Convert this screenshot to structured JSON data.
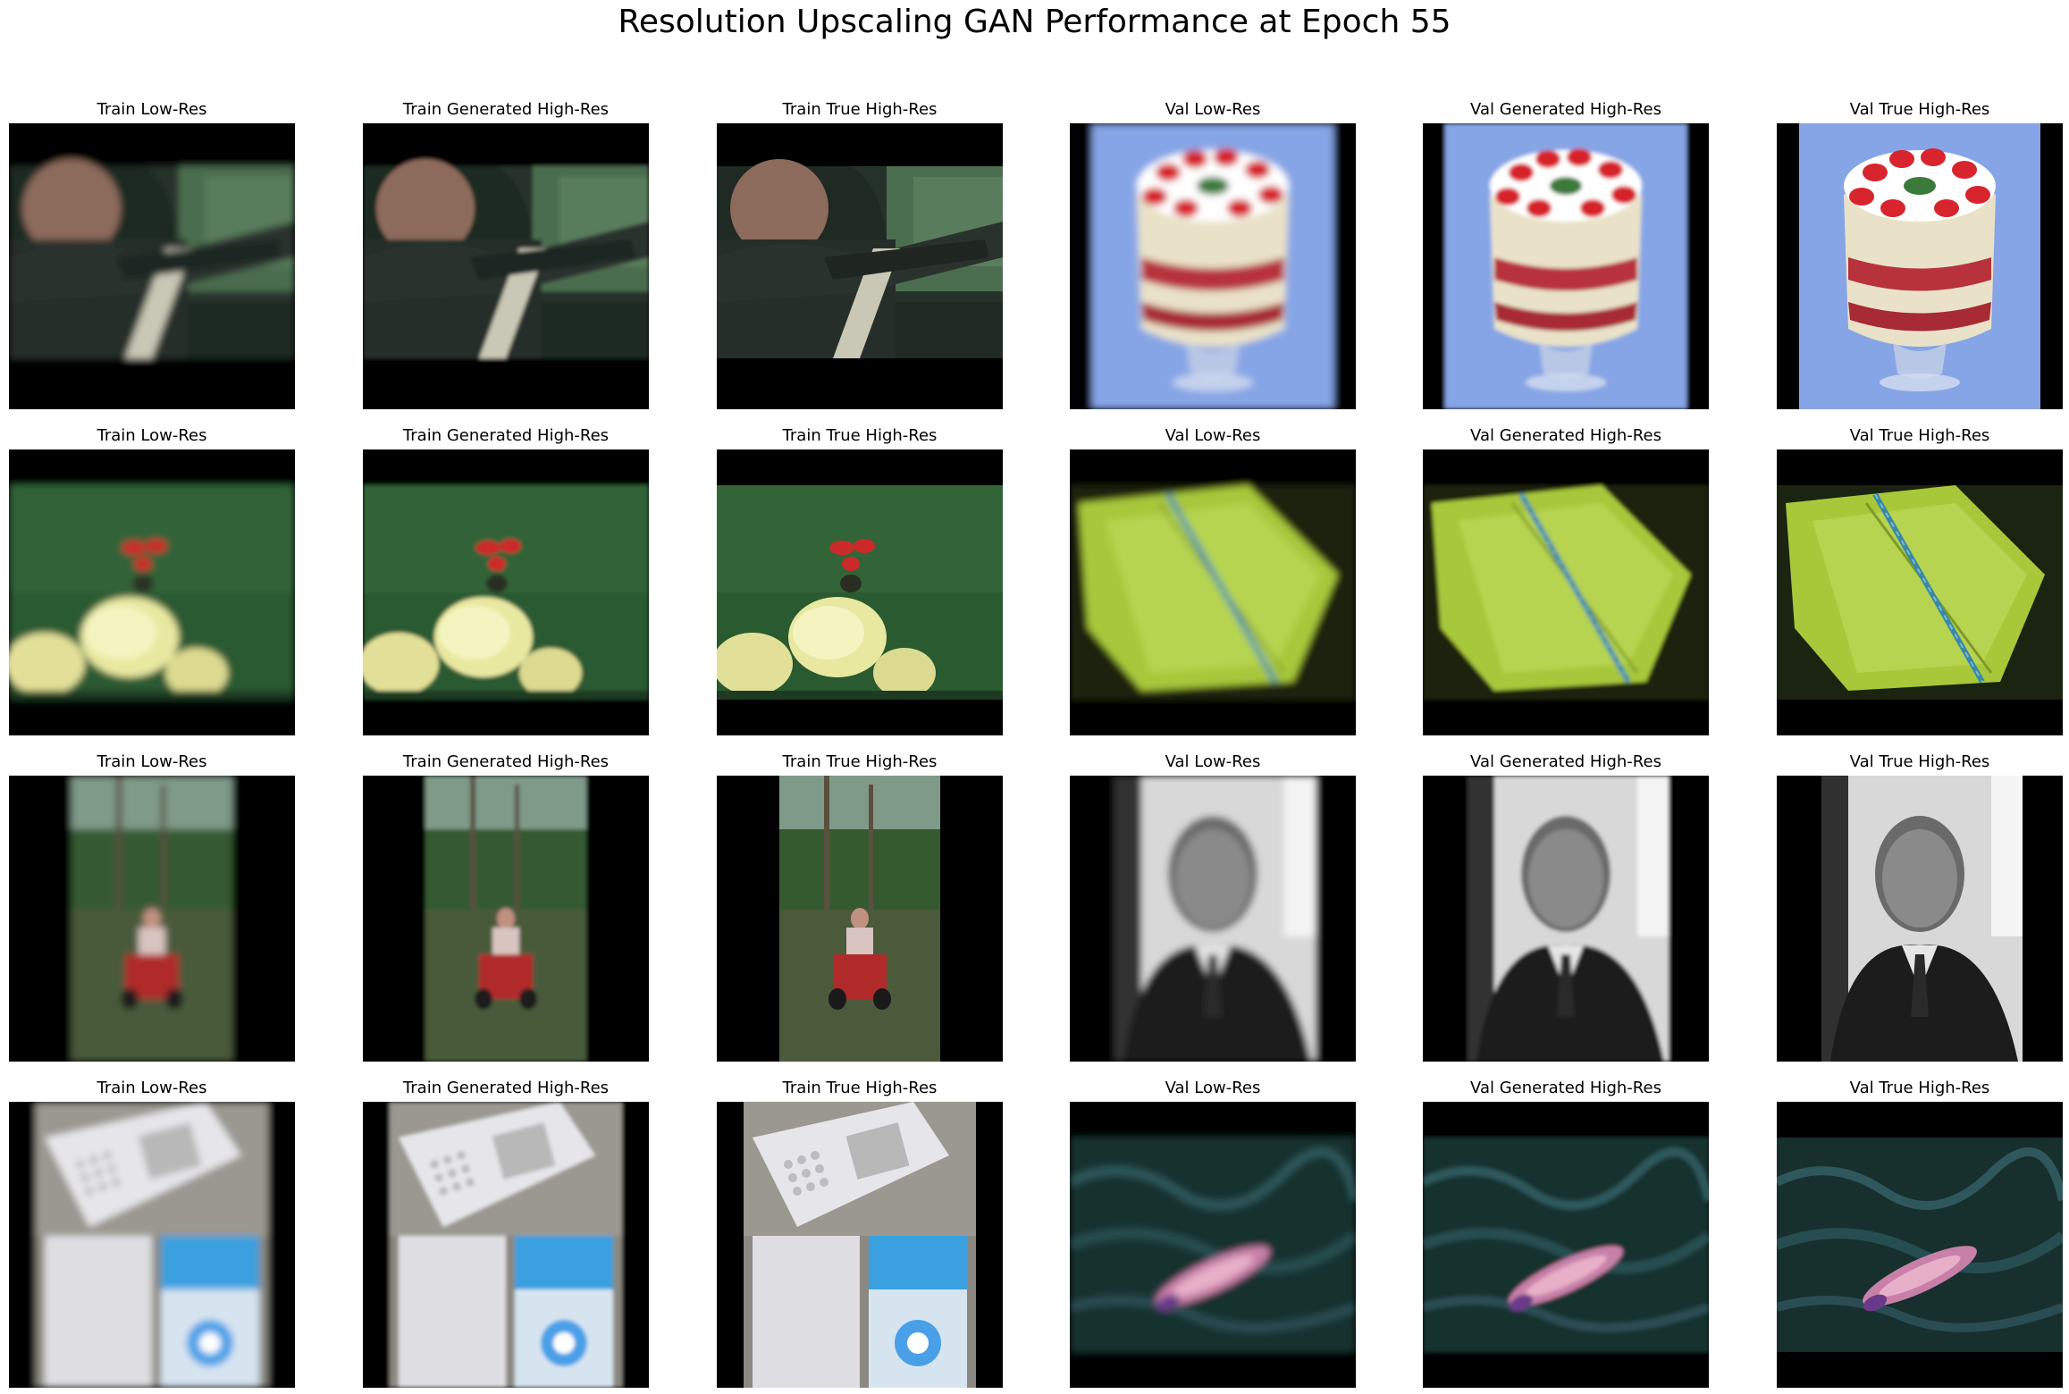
{
  "figure": {
    "title": "Resolution Upscaling GAN Performance at Epoch 55"
  },
  "column_titles": [
    "Train Low-Res",
    "Train Generated High-Res",
    "Train True High-Res",
    "Val Low-Res",
    "Val Generated High-Res",
    "Val True High-Res"
  ],
  "rows": [
    {
      "train_subject": "person driving car wearing seatbelt",
      "val_subject": "strawberry trifle dessert in glass bowl",
      "panels": [
        "Train Low-Res",
        "Train Generated High-Res",
        "Train True High-Res",
        "Val Low-Res",
        "Val Generated High-Res",
        "Val True High-Res"
      ]
    },
    {
      "train_subject": "yellow and red flowers on green background",
      "val_subject": "damselfly on green leaf",
      "panels": [
        "Train Low-Res",
        "Train Generated High-Res",
        "Train True High-Res",
        "Val Low-Res",
        "Val Generated High-Res",
        "Val True High-Res"
      ]
    },
    {
      "train_subject": "child on red ride-on mower in park",
      "val_subject": "black and white portrait of elderly man in suit",
      "panels": [
        "Train Low-Res",
        "Train Generated High-Res",
        "Train True High-Res",
        "Val Low-Res",
        "Val Generated High-Res",
        "Val True High-Res"
      ]
    },
    {
      "train_subject": "white phones and device screen",
      "val_subject": "fish swimming in dark water",
      "panels": [
        "Train Low-Res",
        "Train Generated High-Res",
        "Train True High-Res",
        "Val Low-Res",
        "Val Generated High-Res",
        "Val True High-Res"
      ]
    }
  ]
}
